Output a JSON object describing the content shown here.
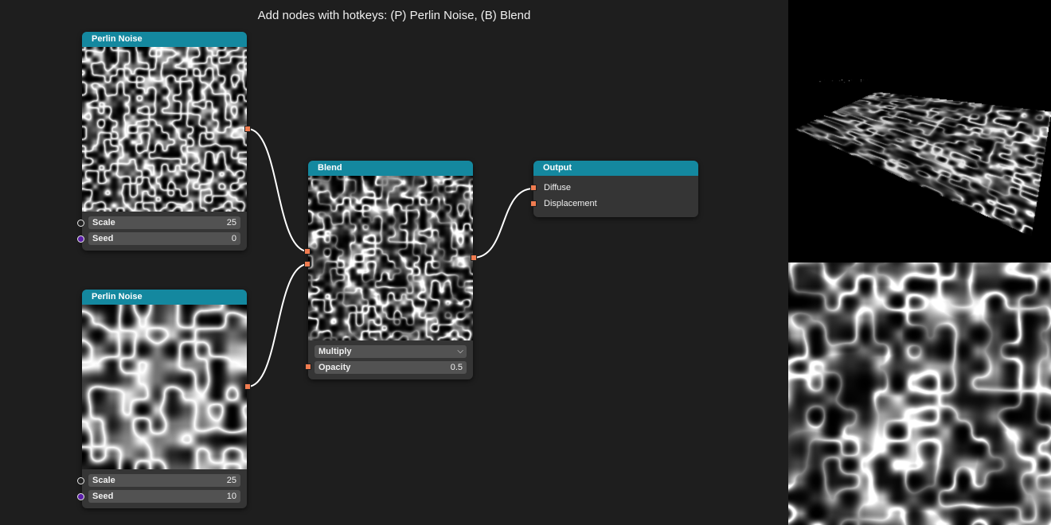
{
  "hint_text": "Add nodes with hotkeys: (P) Perlin Noise, (B) Blend",
  "nodes": {
    "perlin1": {
      "title": "Perlin Noise",
      "params": [
        {
          "label": "Scale",
          "value": "25"
        },
        {
          "label": "Seed",
          "value": "0"
        }
      ]
    },
    "perlin2": {
      "title": "Perlin Noise",
      "params": [
        {
          "label": "Scale",
          "value": "25"
        },
        {
          "label": "Seed",
          "value": "10"
        }
      ]
    },
    "blend": {
      "title": "Blend",
      "mode": "Multiply",
      "opacity_label": "Opacity",
      "opacity_value": "0.5"
    },
    "output": {
      "title": "Output",
      "inputs": [
        "Diffuse",
        "Displacement"
      ]
    }
  },
  "colors": {
    "header": "#14889f",
    "port": "#f07c50",
    "node_bg": "#353535",
    "canvas_bg": "#1e1e1e",
    "wire": "#ffffff"
  }
}
